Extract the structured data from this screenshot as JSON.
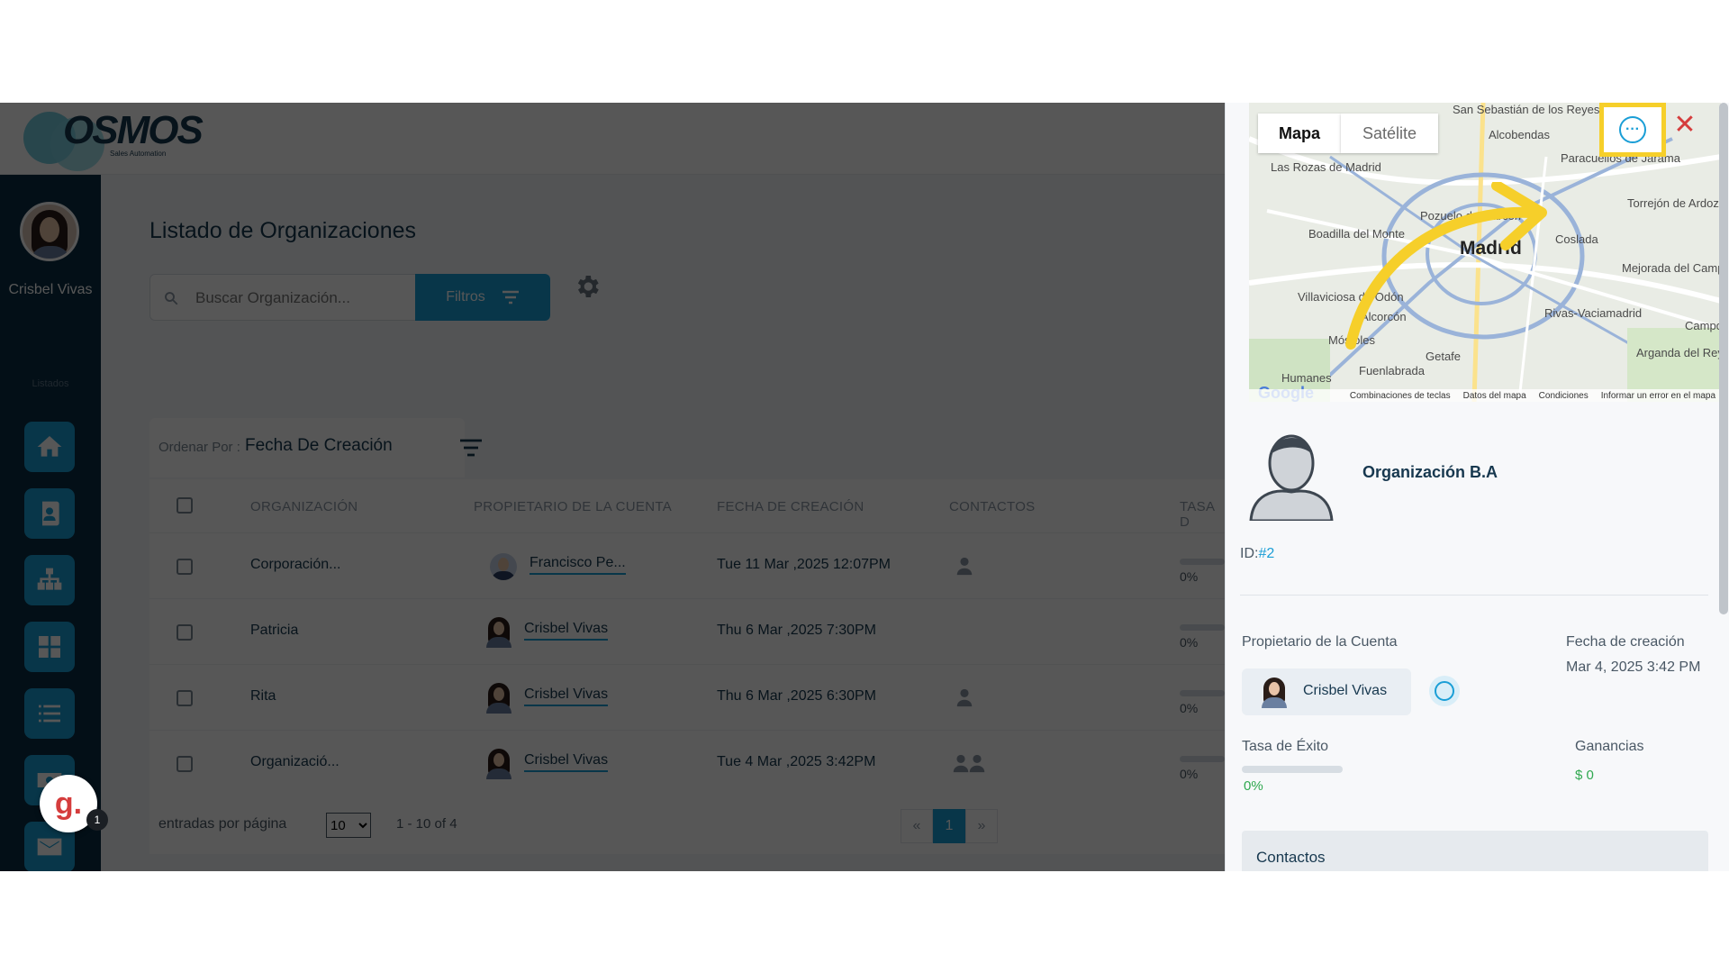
{
  "app": {
    "logo_text": "OSMOS",
    "logo_tagline": "Sales Automation"
  },
  "sidebar": {
    "user_name": "Crisbel Vivas",
    "section_label": "Listados",
    "items": [
      {
        "icon": "home-icon"
      },
      {
        "icon": "contacts-icon"
      },
      {
        "icon": "organizations-icon"
      },
      {
        "icon": "dashboard-icon"
      },
      {
        "icon": "list-icon"
      },
      {
        "icon": "money-icon"
      },
      {
        "icon": "mail-icon"
      }
    ]
  },
  "main": {
    "title": "Listado de Organizaciones",
    "search_placeholder": "Buscar Organización...",
    "filters_label": "Filtros",
    "sort_label": "Ordenar Por :",
    "sort_value": "Fecha De Creación",
    "columns": [
      "ORGANIZACIÓN",
      "PROPIETARIO DE LA CUENTA",
      "FECHA DE CREACIÓN",
      "CONTACTOS",
      "TASA D"
    ],
    "rows": [
      {
        "org": "Corporación...",
        "owner": "Francisco Pe...",
        "date": "Tue 11 Mar ,2025 12:07PM",
        "pct": "0%",
        "contacts": 1,
        "progress": 0
      },
      {
        "org": "Patricia",
        "owner": "Crisbel Vivas",
        "date": "Thu 6 Mar ,2025 7:30PM",
        "pct": "0%",
        "contacts": 0,
        "progress": 0
      },
      {
        "org": "Rita",
        "owner": "Crisbel Vivas",
        "date": "Thu 6 Mar ,2025 6:30PM",
        "pct": "0%",
        "contacts": 1,
        "progress": 0
      },
      {
        "org": "Organizació...",
        "owner": "Crisbel Vivas",
        "date": "Tue 4 Mar ,2025 3:42PM",
        "pct": "0%",
        "contacts": 2,
        "progress": 0
      }
    ],
    "pager": {
      "per_page_label": "entradas por página",
      "per_page_value": "10",
      "range": "1 - 10 of 4",
      "prev": "«",
      "page": "1",
      "next": "»"
    }
  },
  "badge": {
    "letter": "g.",
    "count": "1"
  },
  "panel": {
    "map": {
      "tab_map": "Mapa",
      "tab_satellite": "Satélite",
      "labels": [
        "Las Rozas de Madrid",
        "Pozuelo de Alarcón",
        "Boadilla del Monte",
        "Villaviciosa de Odón",
        "Alcorcón",
        "Móstoles",
        "Fuenlabrada",
        "Getafe",
        "Humanes",
        "Coslada",
        "Torrejón de Ardoz",
        "Mejorada del Campo",
        "Rivas-Vaciamadrid",
        "Arganda del Rey",
        "San Sebastián de los Reyes",
        "Alcobendas",
        "Paracuellos de Jarama",
        "Campo"
      ],
      "city": "Madrid",
      "footer": [
        "Combinaciones de teclas",
        "Datos del mapa",
        "Condiciones",
        "Informar un error en el mapa"
      ],
      "google": "Google"
    },
    "org_name": "Organización B.A",
    "id_label": "ID:",
    "id_value": "#2",
    "owner_label": "Propietario de la Cuenta",
    "owner_name": "Crisbel Vivas",
    "created_label": "Fecha de creación",
    "created_value": "Mar 4, 2025 3:42 PM",
    "rate_label": "Tasa de Éxito",
    "rate_value": "0%",
    "earnings_label": "Ganancias",
    "earnings_value": "$ 0",
    "contacts_title": "Contactos",
    "highlight_color": "#f6cf2a",
    "close_symbol": "✕",
    "more_symbol": "···"
  }
}
